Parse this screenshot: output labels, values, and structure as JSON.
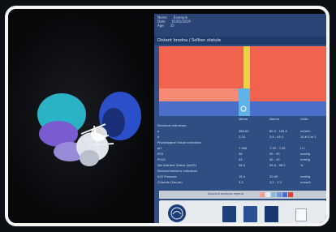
{
  "colors": {
    "heat_red": "#f2634f",
    "heat_salmon": "#f78a74",
    "heat_yellow": "#f0d24a",
    "heat_blue": "#4a6fc8",
    "heat_cyan": "#5fb2e6",
    "brain_cyan": "#2ab3c4",
    "brain_blue": "#2b4fc8",
    "brain_purple": "#7a5bd0"
  },
  "monitor": {
    "info": [
      [
        "Name",
        "Example"
      ],
      [
        "Date",
        "01/02/2019"
      ],
      [
        "Age",
        "35"
      ]
    ],
    "panel_title": "Distant brodna / Sollten statule",
    "table": {
      "headers": [
        "Valore",
        "Norma",
        "Unita"
      ],
      "rows": [
        {
          "label": "Electrical indicators",
          "v": "",
          "n": "",
          "u": ""
        },
        {
          "label": "a",
          "v": "380.00",
          "n": "80.5 - 100.0",
          "u": "ml/min"
        },
        {
          "label": "b",
          "v": "2.20",
          "n": "3.4 - 45.3",
          "u": "10-6 S.m-1"
        },
        {
          "label": "Physiological tissue indicators",
          "v": "",
          "n": "",
          "u": ""
        },
        {
          "label": "pH",
          "v": "7.364",
          "n": "7.35 - 7.45",
          "u": "U.I."
        },
        {
          "label": "PO2",
          "v": "36",
          "n": "90 - 95",
          "u": "mmHg"
        },
        {
          "label": "PCO2",
          "v": "43",
          "n": "40 - 45",
          "u": "mmHg"
        },
        {
          "label": "Sat Nutrient Status (SpO2)",
          "v": "38.4",
          "n": "95.0 - 98.0",
          "u": "%"
        },
        {
          "label": "Electrochemistry indicators",
          "v": "",
          "n": "",
          "u": ""
        },
        {
          "label": "K/Cl Pressure",
          "v": "18.4",
          "n": "20.45",
          "u": "mmHg"
        },
        {
          "label": "Chloride (Serum)",
          "v": "3.2",
          "n": "3.2 - 5.5",
          "u": "mmol/L"
        }
      ]
    },
    "legend_label": "Spectral analysis legend"
  }
}
